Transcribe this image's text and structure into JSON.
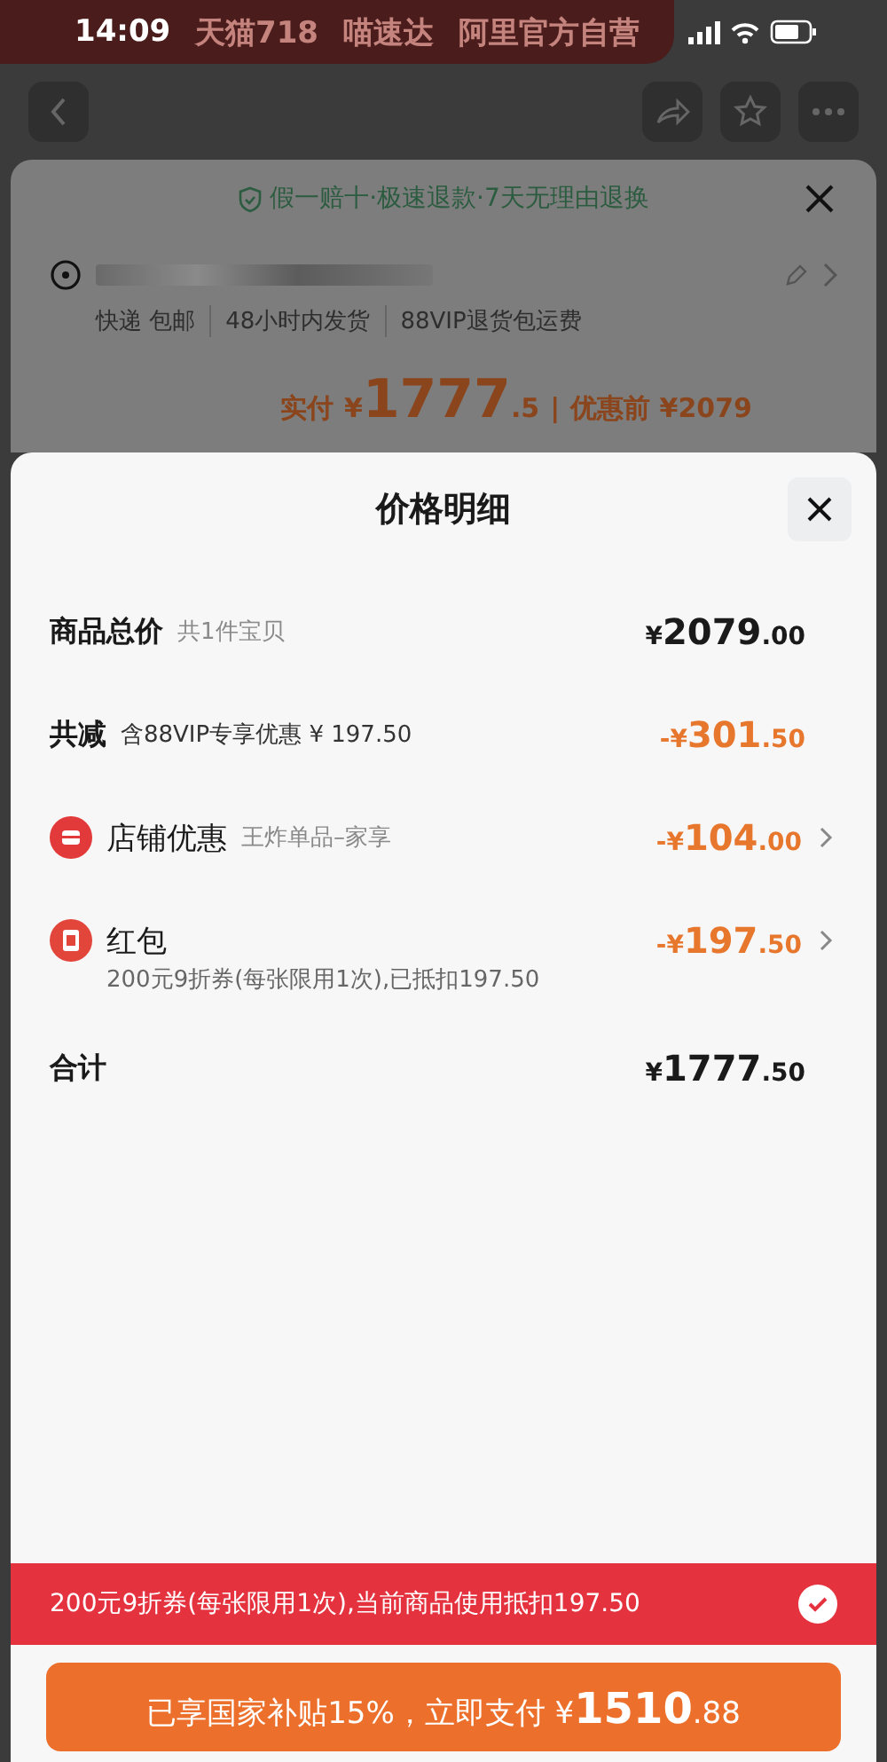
{
  "status_bar": {
    "time": "14:09"
  },
  "background": {
    "banner": [
      "天猫718",
      "喵速达",
      "阿里官方自营"
    ],
    "guarantee": "假一赔十·极速退款·7天无理由退换",
    "shipping": [
      "快递 包邮",
      "48小时内发货",
      "88VIP退货包运费"
    ],
    "paid_label": "实付",
    "paid": {
      "symbol": "¥",
      "integer": "1777",
      "decimal": ".5"
    },
    "separator": "|",
    "before_label": "优惠前",
    "before": "¥2079"
  },
  "sheet": {
    "title": "价格明细",
    "rows": [
      {
        "kind": "plain",
        "label": "商品总价",
        "note": "共1件宝贝",
        "amount": {
          "symbol": "¥",
          "integer": "2079",
          "decimal": ".00"
        },
        "link": false
      },
      {
        "kind": "discount",
        "label": "共减",
        "note": "含88VIP专享优惠 ¥ 197.50",
        "amount": {
          "sign": "-",
          "symbol": "¥",
          "integer": "301",
          "decimal": ".50"
        },
        "link": false
      },
      {
        "kind": "shop",
        "label": "店铺优惠",
        "note": "王炸单品–家享",
        "amount": {
          "sign": "-",
          "symbol": "¥",
          "integer": "104",
          "decimal": ".00"
        },
        "link": true
      },
      {
        "kind": "packet",
        "label": "红包",
        "detail": "200元9折券(每张限用1次),已抵扣197.50",
        "amount": {
          "sign": "-",
          "symbol": "¥",
          "integer": "197",
          "decimal": ".50"
        },
        "link": true
      },
      {
        "kind": "plain",
        "label": "合计",
        "amount": {
          "symbol": "¥",
          "integer": "1777",
          "decimal": ".50"
        },
        "link": false
      }
    ]
  },
  "coupon_bar": {
    "text": "200元9折券(每张限用1次),当前商品使用抵扣197.50",
    "checked": true
  },
  "pay_button": {
    "text": "已享国家补贴15%，立即支付",
    "symbol": "¥",
    "integer": "1510",
    "decimal": ".88"
  }
}
